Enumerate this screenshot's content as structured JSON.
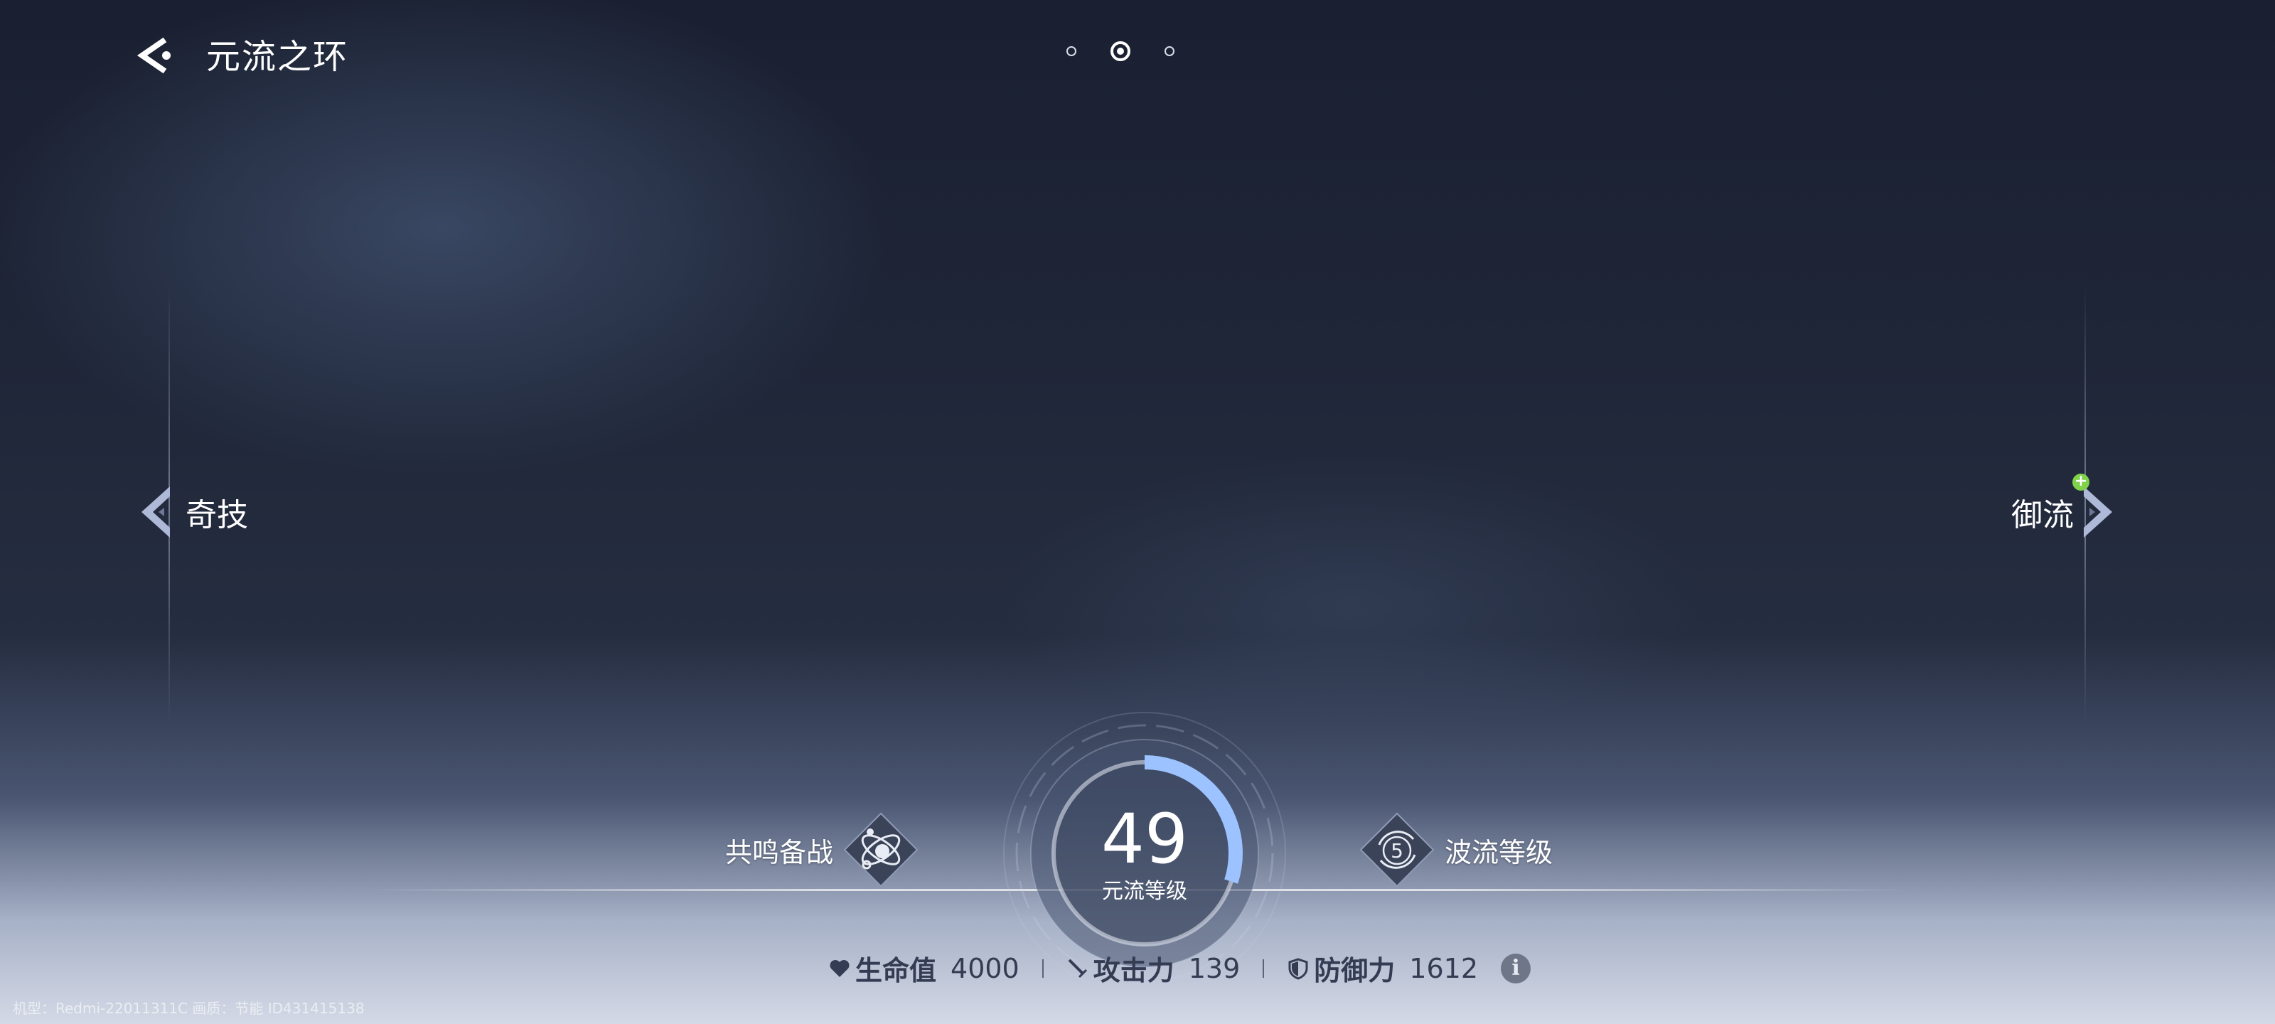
{
  "header": {
    "title": "元流之环",
    "back_icon": "back-arrow-icon"
  },
  "pager": {
    "pages": 3,
    "active_index": 1
  },
  "left_nav": {
    "label": "奇技",
    "icon": "chevron-left-icon"
  },
  "right_nav": {
    "label": "御流",
    "badge": "+",
    "icon": "chevron-right-icon",
    "badge_color": "#7fd24a"
  },
  "features": {
    "left": {
      "label": "共鸣备战",
      "icon": "atom-orbit-icon"
    },
    "right": {
      "label": "波流等级",
      "icon": "wave-level-icon",
      "value": "5"
    }
  },
  "level": {
    "value": "49",
    "label": "元流等级",
    "progress": 0.3
  },
  "stats": [
    {
      "icon": "heart-icon",
      "name": "生命值",
      "value": "4000"
    },
    {
      "icon": "sword-icon",
      "name": "攻击力",
      "value": "139"
    },
    {
      "icon": "shield-icon",
      "name": "防御力",
      "value": "1612"
    }
  ],
  "info_icon": "info-icon",
  "watermark": "机型：Redmi-22011311C 画质：节能 ID431415138"
}
